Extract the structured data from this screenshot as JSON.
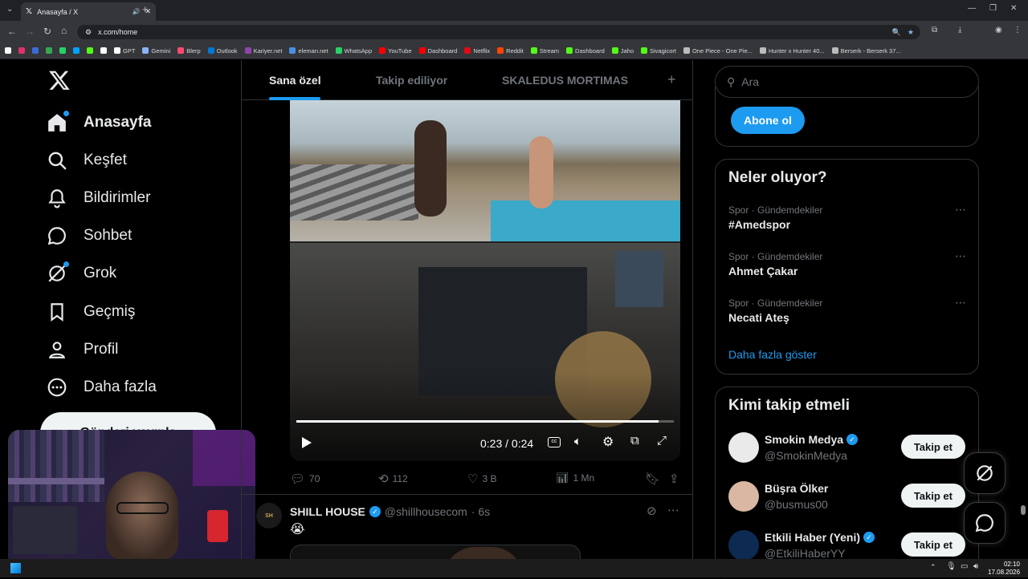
{
  "browser": {
    "tab_title": "Anasayfa / X",
    "url": "x.com/home",
    "bookmarks": [
      {
        "label": "",
        "color": "#ffffff"
      },
      {
        "label": "",
        "color": "#e1306c"
      },
      {
        "label": "",
        "color": "#3b6bd8"
      },
      {
        "label": "",
        "color": "#34a853"
      },
      {
        "label": "",
        "color": "#25d366"
      },
      {
        "label": "",
        "color": "#00a3ff"
      },
      {
        "label": "",
        "color": "#53fc18"
      },
      {
        "label": "",
        "color": "#ffffff"
      },
      {
        "label": "GPT",
        "color": "#ffffff"
      },
      {
        "label": "Gemini",
        "color": "#8ab4f8"
      },
      {
        "label": "Blerp",
        "color": "#ff4b6e"
      },
      {
        "label": "Outlook",
        "color": "#0078d4"
      },
      {
        "label": "Kariyer.net",
        "color": "#8e44ad"
      },
      {
        "label": "eleman.net",
        "color": "#4a90e2"
      },
      {
        "label": "WhatsApp",
        "color": "#25d366"
      },
      {
        "label": "YouTube",
        "color": "#ff0000"
      },
      {
        "label": "Dashboard",
        "color": "#ff0000"
      },
      {
        "label": "Netflix",
        "color": "#e50914"
      },
      {
        "label": "Reddit",
        "color": "#ff4500"
      },
      {
        "label": "Stream",
        "color": "#53fc18"
      },
      {
        "label": "Dashboard",
        "color": "#53fc18"
      },
      {
        "label": "Jaho",
        "color": "#53fc18"
      },
      {
        "label": "Sivagicort",
        "color": "#53fc18"
      },
      {
        "label": "One Piece - One Pie...",
        "color": "#bbbbbb"
      },
      {
        "label": "Hunter x Hunter 40...",
        "color": "#bbbbbb"
      },
      {
        "label": "Berserk - Berserk 37...",
        "color": "#bbbbbb"
      }
    ]
  },
  "nav": {
    "items": [
      {
        "label": "Anasayfa",
        "icon": "home-icon"
      },
      {
        "label": "Keşfet",
        "icon": "search-icon"
      },
      {
        "label": "Bildirimler",
        "icon": "bell-icon"
      },
      {
        "label": "Sohbet",
        "icon": "chat-icon"
      },
      {
        "label": "Grok",
        "icon": "grok-icon"
      },
      {
        "label": "Geçmiş",
        "icon": "bookmark-icon"
      },
      {
        "label": "Profil",
        "icon": "person-icon"
      },
      {
        "label": "Daha fazla",
        "icon": "more-circle-icon"
      }
    ],
    "post_button": "Gönderi yayınla"
  },
  "feed": {
    "tabs": [
      "Sana özel",
      "Takip ediliyor",
      "SKALEDUS MORTIMAS"
    ],
    "video": {
      "time": "0:23 / 0:24",
      "progress": 0.96
    },
    "actions": {
      "replies": "70",
      "reposts": "112",
      "likes": "3 B",
      "views": "1 Mn"
    },
    "next_post": {
      "author": "SHILL HOUSE",
      "handle": "@shillhousecom",
      "time": "· 6s",
      "emoji": "😭"
    }
  },
  "right": {
    "search_placeholder": "Ara",
    "subscribe_button": "Abone ol",
    "trends_title": "Neler oluyor?",
    "trends": [
      {
        "category": "Spor · Gündemdekiler",
        "name": "#Amedspor"
      },
      {
        "category": "Spor · Gündemdekiler",
        "name": "Ahmet Çakar"
      },
      {
        "category": "Spor · Gündemdekiler",
        "name": "Necati Ateş"
      }
    ],
    "show_more": "Daha fazla göster",
    "who_to_follow_title": "Kimi takip etmeli",
    "who_to_follow": [
      {
        "name": "Smokin Medya",
        "handle": "@SmokinMedya",
        "verified": true,
        "button": "Takip et"
      },
      {
        "name": "Büşra Ölker",
        "handle": "@busmus00",
        "verified": false,
        "button": "Takip et"
      },
      {
        "name": "Etkili Haber (Yeni)",
        "handle": "@EtkiliHaberYY",
        "verified": true,
        "button": "Takip et"
      }
    ]
  },
  "taskbar": {
    "time": "02:10",
    "date": "17.08.2026"
  },
  "colors": {
    "accent": "#1d9bf0",
    "subscribe": "#1d9bf0"
  }
}
